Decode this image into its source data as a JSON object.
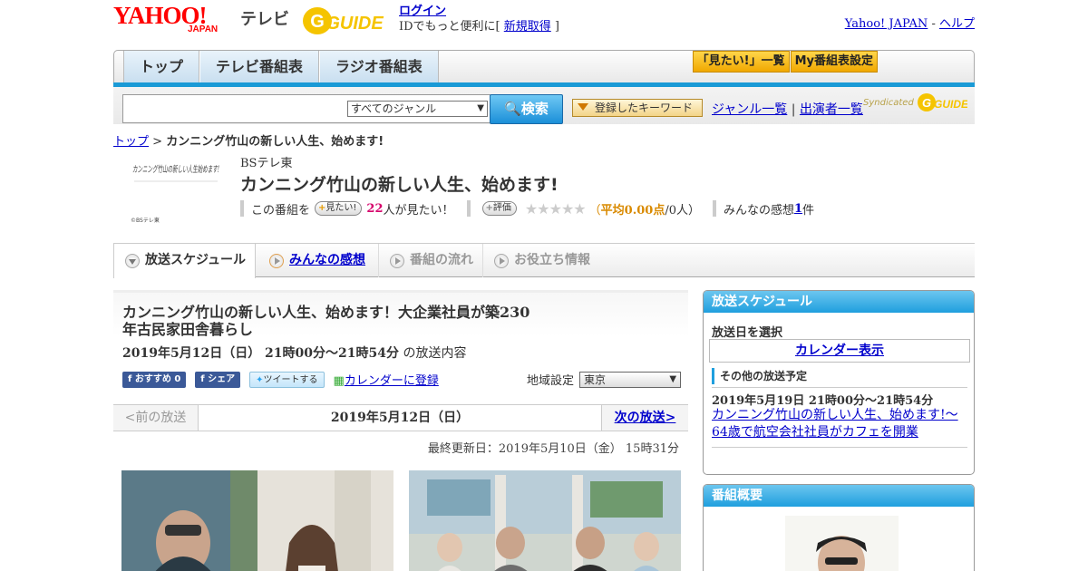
{
  "header": {
    "logo_yahoo": "YAHOO!",
    "logo_japan": "JAPAN",
    "logo_tv": "テレビ",
    "logo_gguide": "GUIDE",
    "login": "ログイン",
    "login_note_pre": "IDでもっと便利に[ ",
    "register": "新規取得",
    "login_note_post": " ]",
    "yahoo_japan": "Yahoo! JAPAN",
    "dash": " - ",
    "help": "ヘルプ"
  },
  "nav": {
    "tabs": [
      "トップ",
      "テレビ番組表",
      "ラジオ番組表"
    ],
    "want_list": "「見たい!」一覧",
    "my_schedule": "My番組表設定"
  },
  "search": {
    "genre": "すべてのジャンル",
    "button": "検索",
    "keyword_button": "登録したキーワード",
    "genre_list": "ジャンル一覧",
    "divider": " | ",
    "cast_list": "出演者一覧",
    "syndicated": "Syndicated"
  },
  "breadcrumb": {
    "top": "トップ",
    "sep": " > ",
    "current": "カンニング竹山の新しい人生、始めます!"
  },
  "program": {
    "thumb_text": "カンニング竹山の新しい人生始めます!",
    "thumb_credit": "©BSテレ東",
    "channel": "BSテレ東",
    "title": "カンニング竹山の新しい人生、始めます!",
    "this_program": "この番組を",
    "want_btn": "見たい!",
    "want_count": "22",
    "want_suffix": "人が見たい！",
    "rate_btn": "評価",
    "stars": "★★★★★",
    "avg_open": "（",
    "avg_label": "平均0.00点",
    "avg_rest": "/0人）",
    "impressions_label": "みんなの感想 ",
    "impressions_count": "1",
    "impressions_unit": "件"
  },
  "subtabs": [
    "放送スケジュール",
    "みんなの感想",
    "番組の流れ",
    "お役立ち情報"
  ],
  "episode": {
    "title": "カンニング竹山の新しい人生、始めます！大企業社員が築230年古民家田舎暮らし",
    "datetime": "2019年5月12日（日） 21時00分～21時54分",
    "datetime_suffix": " の放送内容",
    "fb_recommend": "おすすめ 0",
    "fb_share": "シェア",
    "tweet": "ツイートする",
    "calendar": "カレンダーに登録",
    "region_label": "地域設定",
    "region": "東京"
  },
  "pager": {
    "prev": "<前の放送",
    "current": "2019年5月12日（日）",
    "next": "次の放送>"
  },
  "updated": "最終更新日：2019年5月10日（金） 15時31分",
  "sidebar": {
    "schedule_title": "放送スケジュール",
    "select_date": "放送日を選択",
    "calendar": "カレンダー表示",
    "other_title": "その他の放送予定",
    "other_date": "2019年5月19日 21時00分～21時54分",
    "other_link": "カンニング竹山の新しい人生、始めます!～64歳で航空会社社員がカフェを開業",
    "overview_title": "番組概要"
  },
  "colors": {
    "accent_blue": "#1a9ad6",
    "link": "#0000cc",
    "yahoo_red": "#ff0000",
    "gold": "#f0a800"
  }
}
